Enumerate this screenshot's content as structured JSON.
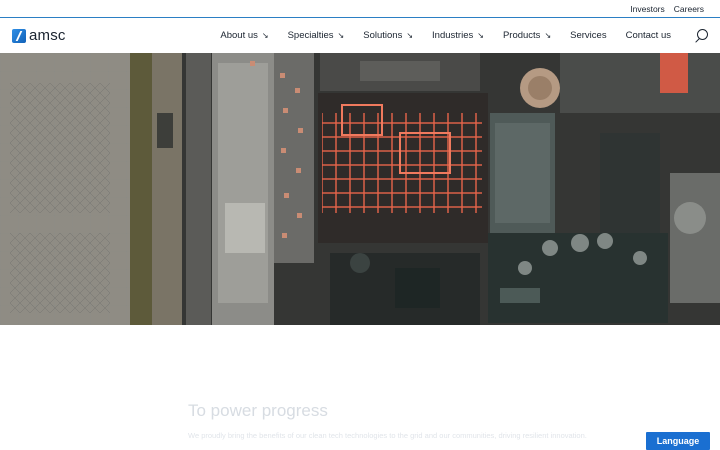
{
  "top_links": {
    "investors": "Investors",
    "careers": "Careers"
  },
  "brand": {
    "name": "amsc",
    "accent": "#1a6fd1"
  },
  "nav": {
    "items": [
      {
        "label": "About us",
        "has_dropdown": true
      },
      {
        "label": "Specialties",
        "has_dropdown": true
      },
      {
        "label": "Solutions",
        "has_dropdown": true
      },
      {
        "label": "Industries",
        "has_dropdown": true
      },
      {
        "label": "Products",
        "has_dropdown": true
      },
      {
        "label": "Services",
        "has_dropdown": false
      },
      {
        "label": "Contact us",
        "has_dropdown": false
      }
    ],
    "search_icon": "search-icon"
  },
  "hero": {
    "image": "aerial view of an industrial power plant"
  },
  "intro": {
    "headline": "To power progress",
    "subline": "We proudly bring the benefits of our clean tech technologies to the grid and our communities, driving resilient innovation."
  },
  "language_button": "Language"
}
